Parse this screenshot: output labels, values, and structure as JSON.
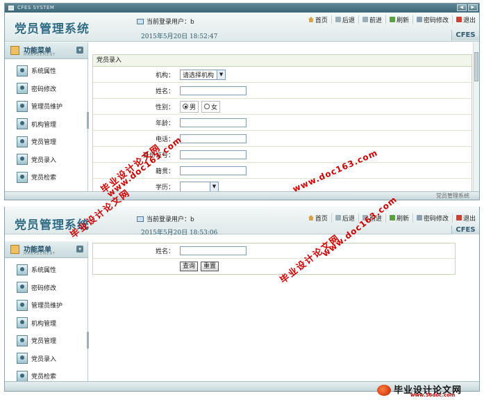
{
  "window": {
    "title": "CFES SYSTEM"
  },
  "header": {
    "app_title": "党员管理系统",
    "user_label": "当前登录用户：b",
    "cfes": "CFES"
  },
  "toolbar": {
    "home": "首页",
    "back": "后退",
    "forward": "前进",
    "refresh": "刷新",
    "change_password": "密码修改",
    "exit": "退出"
  },
  "menu": {
    "title": "功能菜单",
    "subtitle": "MANAGEMENT",
    "items": [
      "系统属性",
      "密码修改",
      "管理员维护",
      "机构管理",
      "党员管理",
      "党员录入",
      "党员检索"
    ]
  },
  "screen1": {
    "datetime": "2015年5月20日  18:52:47",
    "panel_title": "党员录入",
    "fields": {
      "org": "机构：",
      "org_select": "请选择机构",
      "name": "姓名：",
      "gender": "性别：",
      "male": "男",
      "female": "女",
      "age": "年龄：",
      "phone": "电话：",
      "id_card": "身份证号：",
      "native": "籍贯：",
      "more": "学历："
    },
    "status": "党员管理系统"
  },
  "screen2": {
    "datetime": "2015年5月20日  18:53:06",
    "name_label": "姓名：",
    "query_btn": "查询",
    "reset_btn": "重置"
  },
  "watermark": {
    "cn": "毕业设计论文网",
    "url": "www.doc163.com"
  },
  "footer": {
    "brand": "毕业设计论文网",
    "url": "www.56doc.com"
  }
}
